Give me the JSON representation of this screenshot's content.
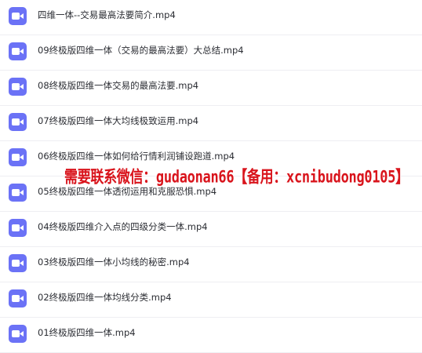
{
  "files": [
    {
      "name": "四维一体--交易最高法要简介.mp4",
      "icon": "video-icon"
    },
    {
      "name": "09终极版四维一体（交易的最高法要）大总结.mp4",
      "icon": "video-icon"
    },
    {
      "name": "08终极版四维一体交易的最高法要.mp4",
      "icon": "video-icon"
    },
    {
      "name": "07终极版四维一体大均线极致运用.mp4",
      "icon": "video-icon"
    },
    {
      "name": "06终极版四维一体如何给行情利润铺设跑道.mp4",
      "icon": "video-icon"
    },
    {
      "name": "05终极版四维一体透彻运用和克服恐惧.mp4",
      "icon": "video-icon"
    },
    {
      "name": "04终极版四维介入点的四级分类一体.mp4",
      "icon": "video-icon"
    },
    {
      "name": "03终极版四维一体小均线的秘密.mp4",
      "icon": "video-icon"
    },
    {
      "name": "02终极版四维一体均线分类.mp4",
      "icon": "video-icon"
    },
    {
      "name": "01终极版四维一体.mp4",
      "icon": "video-icon"
    }
  ],
  "watermark": {
    "text": "需要联系微信：gudaonan66【备用：xcnibudong0105】"
  },
  "colors": {
    "icon_bg": "#6b72f6",
    "text": "#2b2d33",
    "divider": "#eeeef2",
    "watermark": "#d9141c"
  }
}
